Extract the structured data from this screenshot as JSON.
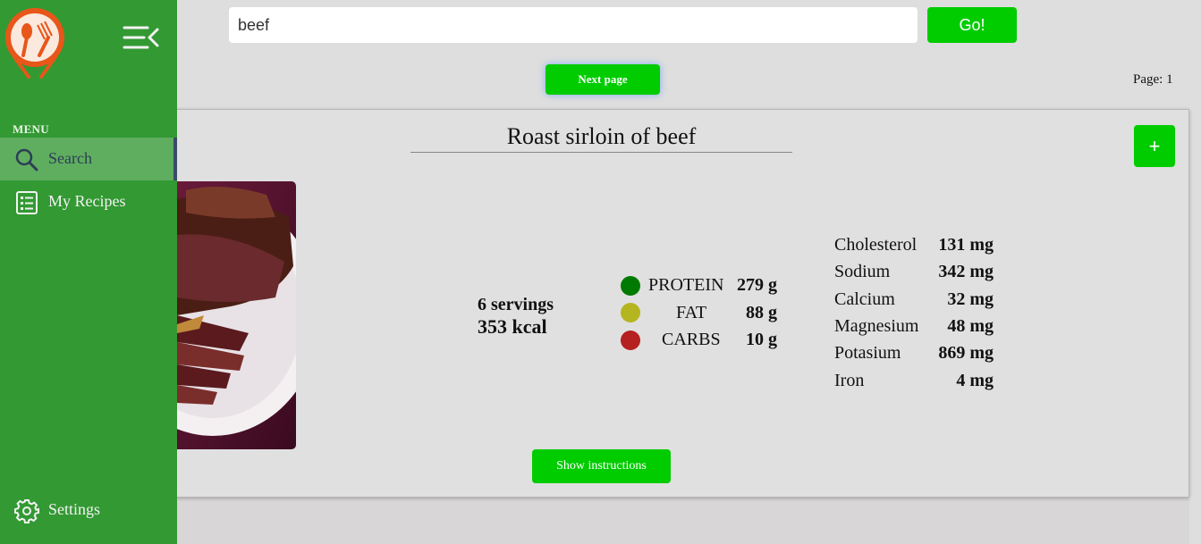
{
  "sidebar": {
    "menu_label": "MENU",
    "items": [
      {
        "label": "Search",
        "icon": "search-icon"
      },
      {
        "label": "My Recipes",
        "icon": "list-icon"
      }
    ],
    "settings_label": "Settings"
  },
  "search": {
    "value": "beef",
    "go_label": "Go!"
  },
  "pager": {
    "next_label": "Next page",
    "page_text": "Page: 1"
  },
  "recipe": {
    "title": "Roast sirloin of beef",
    "add_label": "+",
    "servings": "6 servings",
    "kcal": "353 kcal",
    "macros": [
      {
        "name": "PROTEIN",
        "value": "279 g",
        "color": "#007a00"
      },
      {
        "name": "FAT",
        "value": "88 g",
        "color": "#b5b520"
      },
      {
        "name": "CARBS",
        "value": "10 g",
        "color": "#b52020"
      }
    ],
    "minerals": [
      {
        "name": "Cholesterol",
        "value": "131 mg"
      },
      {
        "name": "Sodium",
        "value": "342 mg"
      },
      {
        "name": "Calcium",
        "value": "32 mg"
      },
      {
        "name": "Magnesium",
        "value": "48 mg"
      },
      {
        "name": "Potasium",
        "value": "869 mg"
      },
      {
        "name": "Iron",
        "value": "4 mg"
      }
    ],
    "show_label": "Show instructions"
  },
  "colors": {
    "sidebar": "#339933",
    "accent": "#00cc00"
  }
}
